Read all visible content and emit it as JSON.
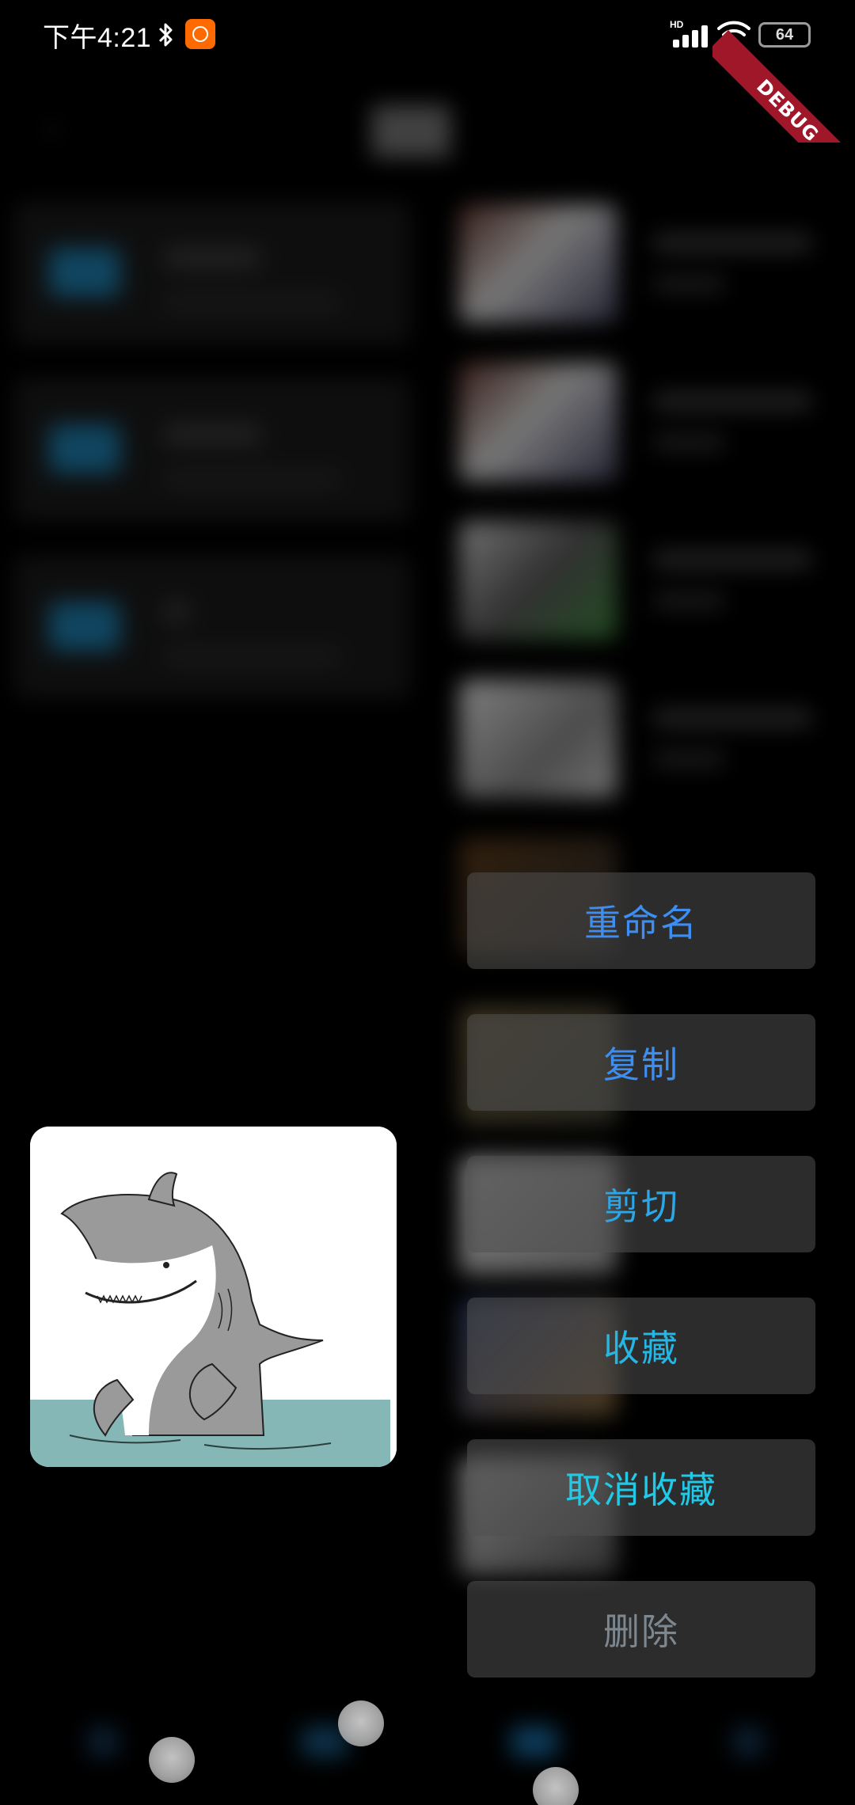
{
  "status_bar": {
    "time": "下午4:21",
    "network_label": "HD",
    "battery": "64"
  },
  "debug_banner": {
    "label": "DEBUG",
    "color": "#a0172a"
  },
  "context_menu": {
    "items": [
      {
        "label": "重命名",
        "color": "#3d8ef0",
        "icon": ""
      },
      {
        "label": "复制",
        "color": "#3d8ef0",
        "icon": ""
      },
      {
        "label": "剪切",
        "color": "#2ba7e8",
        "icon": ""
      },
      {
        "label": "收藏",
        "color": "#26b6e4",
        "icon": ""
      },
      {
        "label": "取消收藏",
        "color": "#22c9e6",
        "icon": ""
      },
      {
        "label": "删除",
        "color": "#7d8790",
        "icon": ""
      }
    ]
  },
  "preview": {
    "subject": "shark-illustration"
  },
  "colors": {
    "background": "#000000",
    "folder_icon": "#1e7fb0",
    "app_notification_icon": "#ff6a00"
  }
}
